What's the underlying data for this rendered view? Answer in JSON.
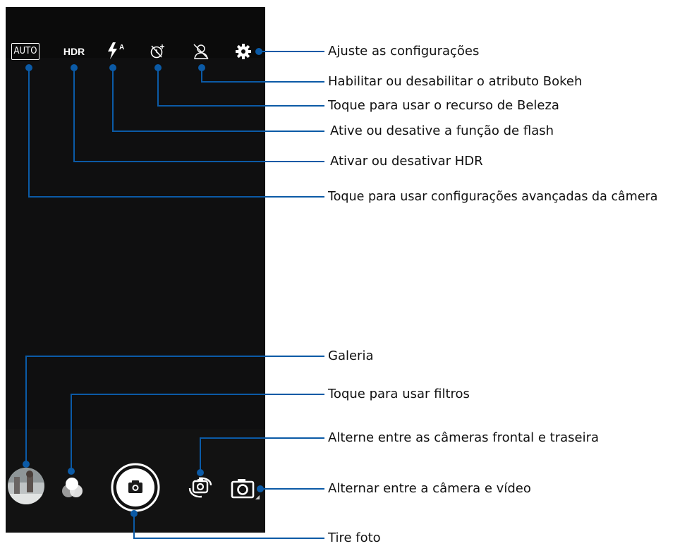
{
  "top_controls": {
    "auto_label": "AUTO",
    "hdr_label": "HDR"
  },
  "callouts": {
    "settings": "Ajuste as configurações",
    "bokeh": "Habilitar ou desabilitar o atributo Bokeh",
    "beauty": "Toque para usar o recurso de Beleza",
    "flash": "Ative ou desative a função de flash",
    "hdr": "Ativar ou desativar HDR",
    "advanced": "Toque para usar configurações avançadas da câmera",
    "gallery": "Galeria",
    "filters": "Toque para usar filtros",
    "switch_camera": "Alterne entre as câmeras frontal e traseira",
    "camera_video": "Alternar entre a câmera e vídeo",
    "shutter": "Tire foto"
  },
  "colors": {
    "callout_line": "#0b5aa6",
    "screen_bg": "#0b0b0b"
  }
}
